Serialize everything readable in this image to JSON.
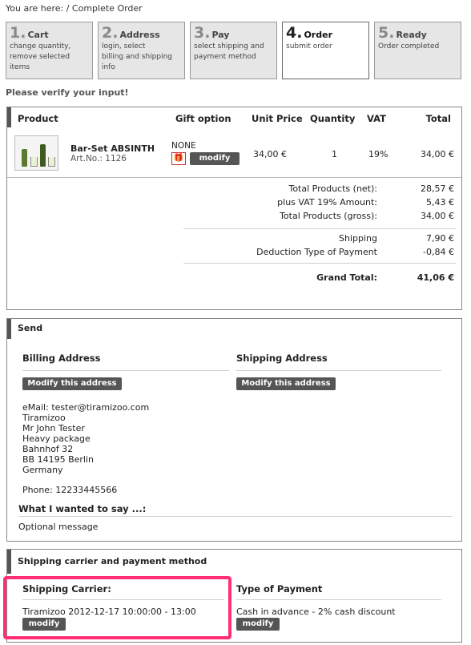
{
  "breadcrumb": "You are here:  / Complete Order",
  "steps": [
    {
      "num": "1.",
      "title": "Cart",
      "desc": [
        "change quantity,",
        "remove selected",
        "items"
      ]
    },
    {
      "num": "2.",
      "title": "Address",
      "desc": [
        "login, select",
        "billing and shipping",
        "info"
      ]
    },
    {
      "num": "3.",
      "title": "Pay",
      "desc": [
        "select shipping and",
        "payment method"
      ]
    },
    {
      "num": "4.",
      "title": "Order",
      "desc": [
        "submit order"
      ]
    },
    {
      "num": "5.",
      "title": "Ready",
      "desc": [
        "Order completed"
      ]
    }
  ],
  "verify_text": "Please verify your input!",
  "table": {
    "headers": {
      "product": "Product",
      "gift": "Gift option",
      "unit_price": "Unit Price",
      "quantity": "Quantity",
      "vat": "VAT",
      "total": "Total"
    },
    "item": {
      "name": "Bar-Set ABSINTH",
      "art_no": "Art.No.:  1126",
      "gift": "NONE",
      "modify": "modify",
      "unit_price": "34,00 €",
      "quantity": "1",
      "vat": "19%",
      "total": "34,00 €"
    },
    "summary": [
      {
        "label": "Total Products (net):",
        "value": "28,57 €"
      },
      {
        "label": "plus VAT 19% Amount:",
        "value": "5,43 €"
      },
      {
        "label": "Total Products (gross):",
        "value": "34,00 €"
      },
      {
        "label": "Shipping",
        "value": "7,90 €"
      },
      {
        "label": "Deduction Type of Payment",
        "value": "-0,84 €"
      }
    ],
    "grand_total": {
      "label": "Grand Total:",
      "value": "41,06 €"
    }
  },
  "send": {
    "title": "Send",
    "billing_title": "Billing Address",
    "shipping_title": "Shipping Address",
    "modify_address": "Modify this address",
    "address_lines": [
      "eMail: tester@tiramizoo.com",
      "Tiramizoo",
      "Mr John Tester",
      "Heavy package",
      "Bahnhof 32",
      "BB 14195 Berlin",
      "Germany"
    ],
    "phone": "Phone: 12233445566",
    "message_title": "What I wanted to say ...:",
    "message": "Optional message"
  },
  "carrier_box": {
    "title": "Shipping carrier and payment method",
    "carrier_title": "Shipping Carrier:",
    "carrier_value": "Tiramizoo   2012-12-17 10:00:00 - 13:00",
    "payment_title": "Type of Payment",
    "payment_value": "Cash in advance - 2% cash discount",
    "modify": "modify"
  },
  "colors": {
    "highlight": "#ff2e75",
    "button": "#555555",
    "active_step": "#ffffff",
    "inactive_step": "#e6e6e6"
  }
}
